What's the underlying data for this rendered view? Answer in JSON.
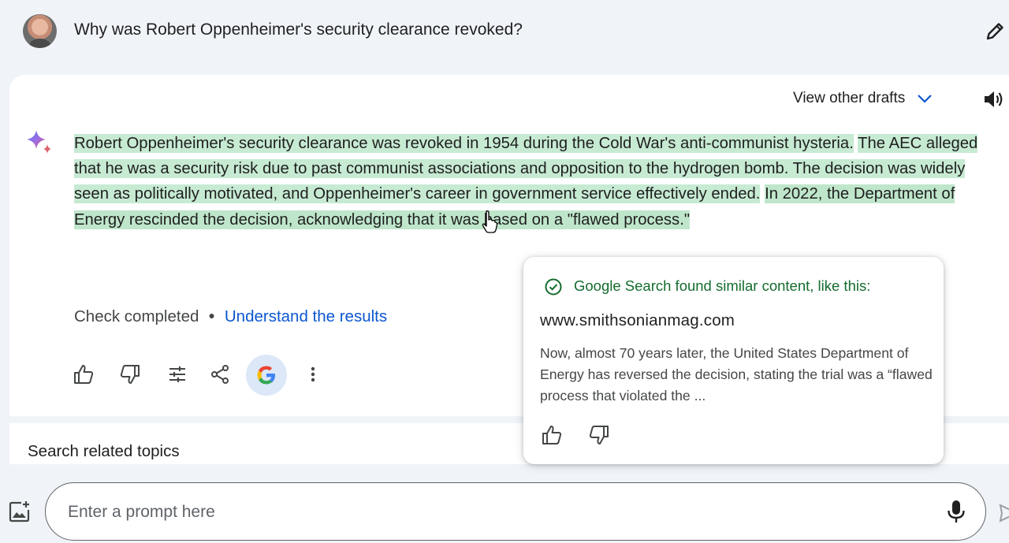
{
  "prompt": {
    "query": "Why was Robert Oppenheimer's security clearance revoked?"
  },
  "response": {
    "drafts_label": "View other drafts",
    "segments": [
      "Robert Oppenheimer's security clearance was revoked in 1954 during the Cold War's anti-communist hysteria.",
      "The AEC alleged that he was a security risk due to past communist associations and opposition to the hydrogen bomb. The decision was widely seen as politically motivated, and Oppenheimer's career in government service effectively ended.",
      "In 2022, the Department of Energy rescinded the decision, acknowledging that it was based on a \"flawed process.\""
    ],
    "check_status": "Check completed",
    "understand_link": "Understand the results"
  },
  "related": {
    "label": "Search related topics"
  },
  "popover": {
    "title": "Google Search found similar content, like this:",
    "domain": "www.smithsonianmag.com",
    "snippet": "Now, almost 70 years later, the United States Department of Energy has reversed the decision, stating the trial was a “flawed process that violated the ..."
  },
  "input": {
    "placeholder": "Enter a prompt here"
  },
  "colors": {
    "background": "#f0f4f9",
    "highlight_green": "#c7ead3",
    "link_blue": "#0b57d0",
    "popover_title_green": "#146c2e",
    "google_button_bg": "#dce7f8"
  },
  "icons": {
    "edit": "pencil-icon",
    "drafts": "chevron-down-icon",
    "speaker": "speaker-icon",
    "gemini": "gemini-sparkle-icon",
    "actions": [
      "thumbs-up-icon",
      "thumbs-down-icon",
      "tune-icon",
      "share-icon",
      "google-g-icon",
      "more-vert-icon"
    ],
    "popover_check": "check-circle-icon",
    "add_image": "add-image-icon",
    "mic": "mic-icon",
    "send": "send-icon"
  }
}
